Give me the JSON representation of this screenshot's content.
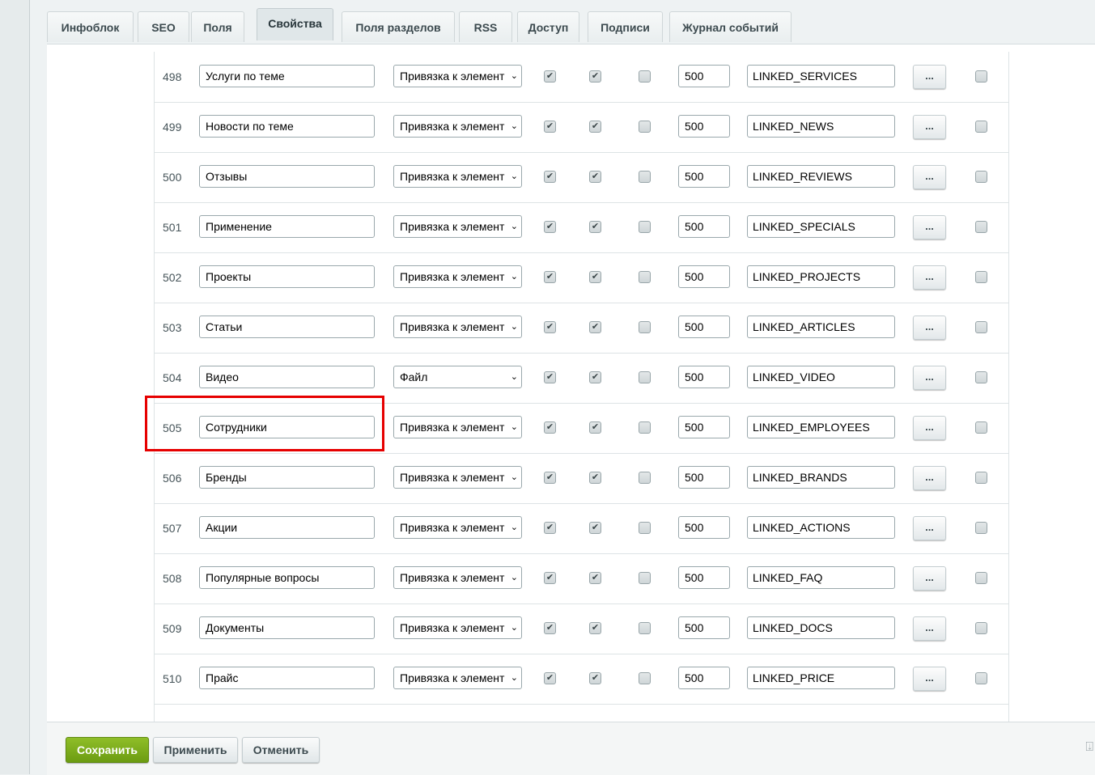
{
  "tabs": [
    {
      "label": "Инфоблок"
    },
    {
      "label": "SEO"
    },
    {
      "label": "Поля"
    },
    {
      "label": "Свойства"
    },
    {
      "label": "Поля разделов"
    },
    {
      "label": "RSS"
    },
    {
      "label": "Доступ"
    },
    {
      "label": "Подписи"
    },
    {
      "label": "Журнал событий"
    }
  ],
  "active_tab": "Свойства",
  "rows": [
    {
      "id": "498",
      "name": "Услуги по теме",
      "type": "Привязка к элемент",
      "c1": true,
      "c2": true,
      "c3": false,
      "sort": "500",
      "code": "LINKED_SERVICES",
      "more": "...",
      "c4": false
    },
    {
      "id": "499",
      "name": "Новости по теме",
      "type": "Привязка к элемент",
      "c1": true,
      "c2": true,
      "c3": false,
      "sort": "500",
      "code": "LINKED_NEWS",
      "more": "...",
      "c4": false
    },
    {
      "id": "500",
      "name": "Отзывы",
      "type": "Привязка к элемент",
      "c1": true,
      "c2": true,
      "c3": false,
      "sort": "500",
      "code": "LINKED_REVIEWS",
      "more": "...",
      "c4": false
    },
    {
      "id": "501",
      "name": "Применение",
      "type": "Привязка к элемент",
      "c1": true,
      "c2": true,
      "c3": false,
      "sort": "500",
      "code": "LINKED_SPECIALS",
      "more": "...",
      "c4": false
    },
    {
      "id": "502",
      "name": "Проекты",
      "type": "Привязка к элемент",
      "c1": true,
      "c2": true,
      "c3": false,
      "sort": "500",
      "code": "LINKED_PROJECTS",
      "more": "...",
      "c4": false
    },
    {
      "id": "503",
      "name": "Статьи",
      "type": "Привязка к элемент",
      "c1": true,
      "c2": true,
      "c3": false,
      "sort": "500",
      "code": "LINKED_ARTICLES",
      "more": "...",
      "c4": false
    },
    {
      "id": "504",
      "name": "Видео",
      "type": "Файл",
      "c1": true,
      "c2": true,
      "c3": false,
      "sort": "500",
      "code": "LINKED_VIDEO",
      "more": "...",
      "c4": false
    },
    {
      "id": "505",
      "name": "Сотрудники",
      "type": "Привязка к элемент",
      "c1": true,
      "c2": true,
      "c3": false,
      "sort": "500",
      "code": "LINKED_EMPLOYEES",
      "more": "...",
      "c4": false
    },
    {
      "id": "506",
      "name": "Бренды",
      "type": "Привязка к элемент",
      "c1": true,
      "c2": true,
      "c3": false,
      "sort": "500",
      "code": "LINKED_BRANDS",
      "more": "...",
      "c4": false
    },
    {
      "id": "507",
      "name": "Акции",
      "type": "Привязка к элемент",
      "c1": true,
      "c2": true,
      "c3": false,
      "sort": "500",
      "code": "LINKED_ACTIONS",
      "more": "...",
      "c4": false
    },
    {
      "id": "508",
      "name": "Популярные вопросы",
      "type": "Привязка к элемент",
      "c1": true,
      "c2": true,
      "c3": false,
      "sort": "500",
      "code": "LINKED_FAQ",
      "more": "...",
      "c4": false
    },
    {
      "id": "509",
      "name": "Документы",
      "type": "Привязка к элемент",
      "c1": true,
      "c2": true,
      "c3": false,
      "sort": "500",
      "code": "LINKED_DOCS",
      "more": "...",
      "c4": false
    },
    {
      "id": "510",
      "name": "Прайс",
      "type": "Привязка к элемент",
      "c1": true,
      "c2": true,
      "c3": false,
      "sort": "500",
      "code": "LINKED_PRICE",
      "more": "...",
      "c4": false
    }
  ],
  "highlighted_row": "505",
  "footer": {
    "save_label": "Сохранить",
    "apply_label": "Применить",
    "cancel_label": "Отменить"
  },
  "icons": {
    "checkbox_checked": "check-icon",
    "select_arrow": "chevron-down-icon",
    "footer_pin": "pin-icon"
  },
  "colors": {
    "save_button": "#7aab1a",
    "highlight_border": "#e60000"
  }
}
